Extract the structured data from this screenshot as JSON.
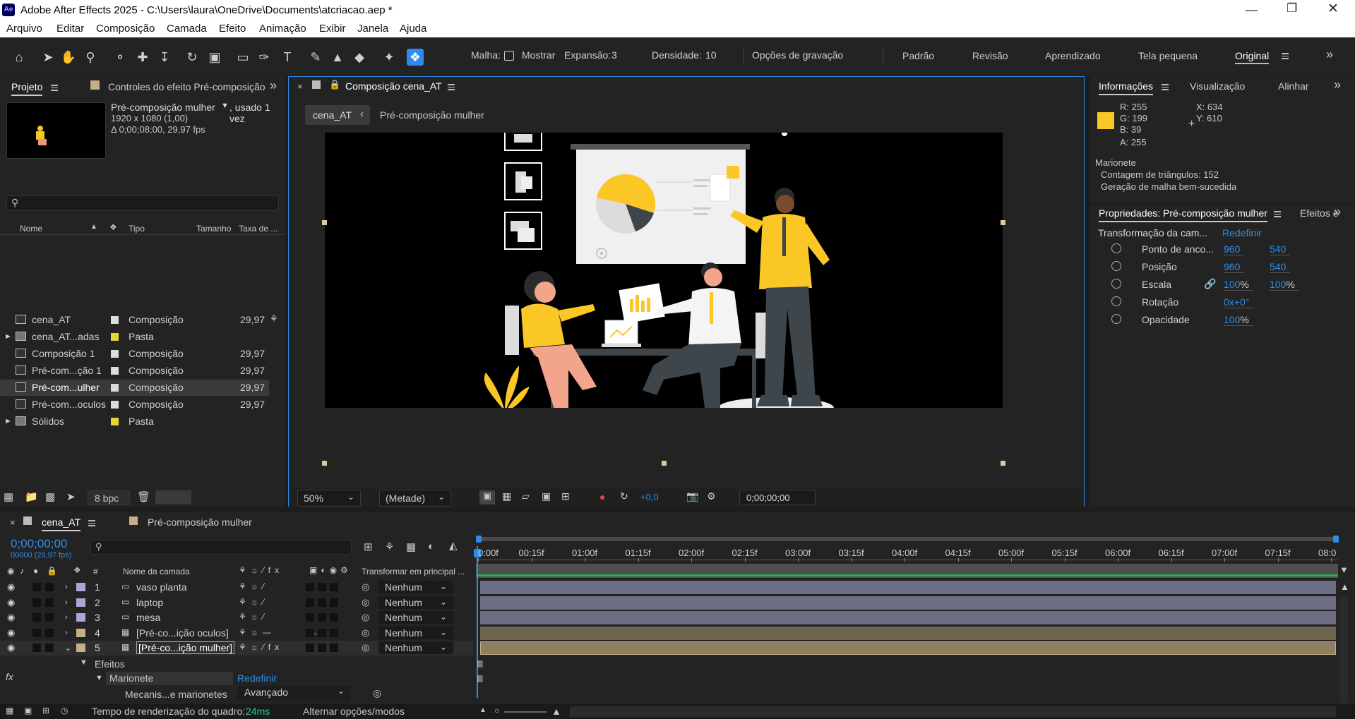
{
  "app": {
    "title": "Adobe After Effects 2025 - C:\\Users\\laura\\OneDrive\\Documents\\atcriacao.aep *",
    "logo": "Ae"
  },
  "menu": [
    "Arquivo",
    "Editar",
    "Composição",
    "Camada",
    "Efeito",
    "Animação",
    "Exibir",
    "Janela",
    "Ajuda"
  ],
  "toolbar": {
    "malha_label": "Malha:",
    "mostrar_label": "Mostrar",
    "expansao_label": "Expansão:",
    "expansao_value": "3",
    "densidade_label": "Densidade:",
    "densidade_value": "10",
    "gravacao_label": "Opções de gravação"
  },
  "workspaces": [
    "Padrão",
    "Revisão",
    "Aprendizado",
    "Tela pequena",
    "Original"
  ],
  "project": {
    "tab_label": "Projeto",
    "effects_tab_label": "Controles do efeito Pré-composição",
    "selected_name": "Pré-composição mulher",
    "used": ", usado 1 vez",
    "dimensions": "1920 x 1080 (1,00)",
    "duration": "Δ 0;00;08;00, 29,97 fps",
    "columns": {
      "name": "Nome",
      "type": "Tipo",
      "size": "Tamanho",
      "rate": "Taxa de ..."
    },
    "items": [
      {
        "name": "cena_AT",
        "type": "Composição",
        "rate": "29,97",
        "color": "#dcdcdc"
      },
      {
        "name": "cena_AT...adas",
        "type": "Pasta",
        "rate": "",
        "color": "#e5d43a"
      },
      {
        "name": "Composição 1",
        "type": "Composição",
        "rate": "29,97",
        "color": "#dcdcdc"
      },
      {
        "name": "Pré-com...ção 1",
        "type": "Composição",
        "rate": "29,97",
        "color": "#dcdcdc"
      },
      {
        "name": "Pré-com...ulher",
        "type": "Composição",
        "rate": "29,97",
        "color": "#dcdcdc"
      },
      {
        "name": "Pré-com...oculos",
        "type": "Composição",
        "rate": "29,97",
        "color": "#dcdcdc"
      },
      {
        "name": "Sólidos",
        "type": "Pasta",
        "rate": "",
        "color": "#e5d43a"
      }
    ],
    "bpc_label": "8 bpc"
  },
  "composition": {
    "tab_label": "Composição cena_AT",
    "crumb_active": "cena_AT",
    "crumb_next": "Pré-composição mulher",
    "zoom": "50%",
    "resolution": "(Metade)",
    "exposure": "+0,0",
    "timecode": "0;00;00;00"
  },
  "info": {
    "tab_label": "Informações",
    "visualizacao_label": "Visualização",
    "alinhar_label": "Alinhar",
    "r": "R:  255",
    "g": "G:  199",
    "b": "B:  39",
    "a": "A:  255",
    "x": "X:  634",
    "y": "Y:  610",
    "swatch_color": "#fbc727",
    "marionete_title": "Marionete",
    "triangles": "Contagem de triângulos: 152",
    "mesh": "Geração de malha bem-sucedida"
  },
  "properties": {
    "tab_label": "Propriedades: Pré-composição mulher",
    "effects_tab": "Efeitos e",
    "section_label": "Transformação da cam...",
    "reset_label": "Redefinir",
    "rows": [
      {
        "label": "Ponto de anco...",
        "v1": "960",
        "v2": "540",
        "unit": ""
      },
      {
        "label": "Posição",
        "v1": "960",
        "v2": "540",
        "unit": ""
      },
      {
        "label": "Escala",
        "v1": "100",
        "v2": "100",
        "unit": "%"
      },
      {
        "label": "Rotação",
        "v1": "0x+0°",
        "v2": "",
        "unit": ""
      },
      {
        "label": "Opacidade",
        "v1": "100",
        "v2": "",
        "unit": "%"
      }
    ]
  },
  "timeline": {
    "tab_label": "cena_AT",
    "tab2_label": "Pré-composição mulher",
    "timecode": "0;00;00;00",
    "fps": "00000 (29,97 fps)",
    "col_hash": "#",
    "col_name": "Nome da camada",
    "col_transform": "Transformar em principal ...",
    "ruler": [
      "0:00f",
      "00:15f",
      "01:00f",
      "01:15f",
      "02:00f",
      "02:15f",
      "03:00f",
      "03:15f",
      "04:00f",
      "04:15f",
      "05:00f",
      "05:15f",
      "06:00f",
      "06:15f",
      "07:00f",
      "07:15f",
      "08:0"
    ],
    "layers": [
      {
        "num": "1",
        "name": "vaso planta",
        "parent": "Nenhum",
        "color": "#a9a7d6"
      },
      {
        "num": "2",
        "name": "laptop",
        "parent": "Nenhum",
        "color": "#a9a7d6"
      },
      {
        "num": "3",
        "name": "mesa",
        "parent": "Nenhum",
        "color": "#a9a7d6"
      },
      {
        "num": "4",
        "name": "[Pré-co...ição oculos]",
        "parent": "Nenhum",
        "color": "#c6ae86"
      },
      {
        "num": "5",
        "name": "[Pré-co...ição mulher]",
        "parent": "Nenhum",
        "color": "#c6ae86"
      }
    ],
    "effects_label": "Efeitos",
    "marionete_label": "Marionete",
    "marionete_reset": "Redefinir",
    "mech_label": "Mecanis...e marionetes",
    "mech_value": "Avançado",
    "render_label": "Tempo de renderização do quadro:",
    "render_value": "24ms",
    "toggle_label": "Alternar opções/modos"
  }
}
